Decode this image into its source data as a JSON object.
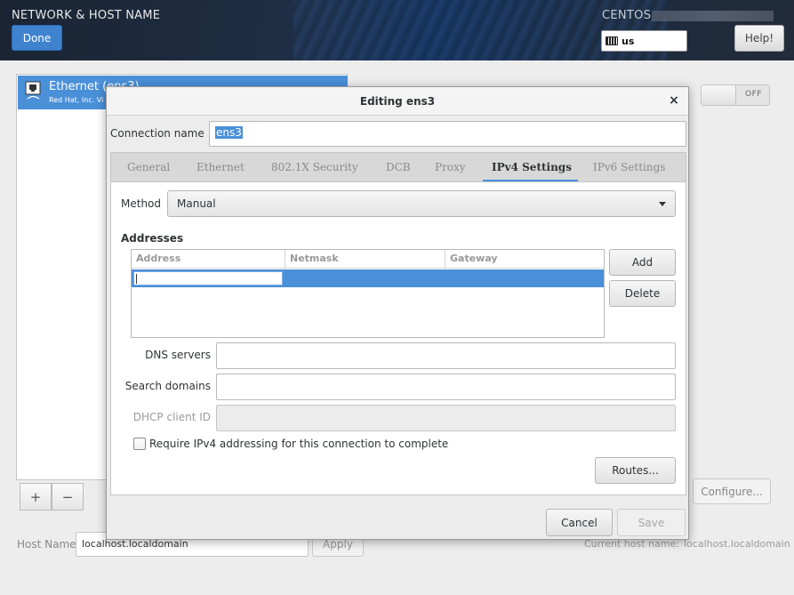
{
  "header": {
    "title": "NETWORK & HOST NAME",
    "done_label": "Done",
    "product": "CENTOS",
    "keyboard_layout": "us",
    "help_label": "Help!"
  },
  "devices": {
    "items": [
      {
        "name": "Ethernet (ens3)",
        "subtitle": "Red Hat, Inc. Vi"
      }
    ],
    "add_label": "+",
    "remove_label": "−"
  },
  "device_toggle": {
    "state_label": "OFF"
  },
  "configure_label": "Configure...",
  "hostname": {
    "label": "Host Name:",
    "value": "localhost.localdomain",
    "apply_label": "Apply",
    "current_label": "Current host name:",
    "current_value": "localhost.localdomain"
  },
  "dialog": {
    "title": "Editing ens3",
    "close_glyph": "×",
    "connection_name_label": "Connection name",
    "connection_name_value": "ens3",
    "tabs": [
      {
        "label": "General",
        "active": false
      },
      {
        "label": "Ethernet",
        "active": false
      },
      {
        "label": "802.1X Security",
        "active": false
      },
      {
        "label": "DCB",
        "active": false
      },
      {
        "label": "Proxy",
        "active": false
      },
      {
        "label": "IPv4 Settings",
        "active": true
      },
      {
        "label": "IPv6 Settings",
        "active": false
      }
    ],
    "method_label": "Method",
    "method_value": "Manual",
    "addresses_label": "Addresses",
    "address_columns": [
      "Address",
      "Netmask",
      "Gateway"
    ],
    "add_label": "Add",
    "delete_label": "Delete",
    "dns_label": "DNS servers",
    "search_label": "Search domains",
    "dhcp_label": "DHCP client ID",
    "require_label": "Require IPv4 addressing for this connection to complete",
    "require_checked": false,
    "routes_label": "Routes...",
    "cancel_label": "Cancel",
    "save_label": "Save"
  },
  "colors": {
    "accent": "#4a90d9",
    "done_button": "#3f83cf"
  }
}
